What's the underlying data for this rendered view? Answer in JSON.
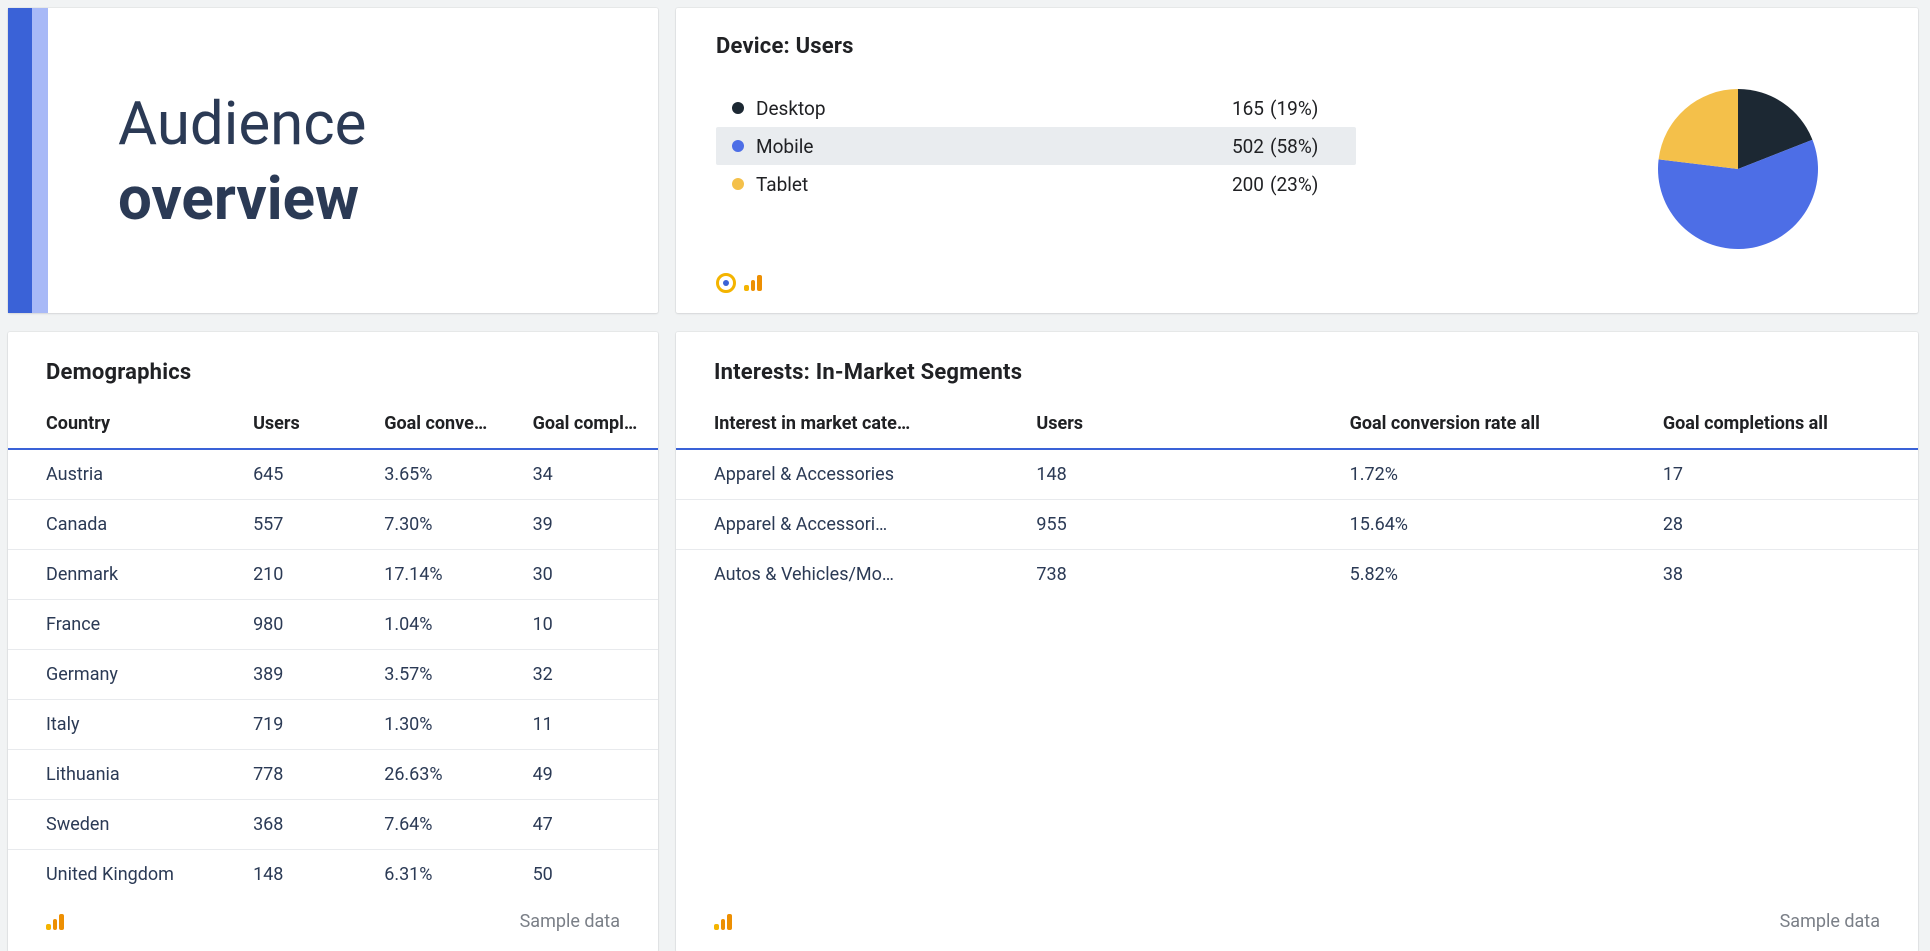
{
  "colors": {
    "accent": "#3a62d7",
    "accent_light": "#a8b9f7",
    "yellow": "#f4b400",
    "dark": "#1c2833"
  },
  "title": {
    "line1": "Audience",
    "line2": "overview"
  },
  "device_card": {
    "title": "Device: Users",
    "selected_index": 1,
    "rows": [
      {
        "label": "Desktop",
        "value": "165",
        "pct": "(19%)",
        "color": "#1c2833"
      },
      {
        "label": "Mobile",
        "value": "502",
        "pct": "(58%)",
        "color": "#4d6ee6"
      },
      {
        "label": "Tablet",
        "value": "200",
        "pct": "(23%)",
        "color": "#f4c04a"
      }
    ]
  },
  "demographics": {
    "title": "Demographics",
    "columns": [
      "Country",
      "Users",
      "Goal conve…",
      "Goal compl…"
    ],
    "rows": [
      {
        "c0": "Austria",
        "c1": "645",
        "c2": "3.65%",
        "c3": "34"
      },
      {
        "c0": "Canada",
        "c1": "557",
        "c2": "7.30%",
        "c3": "39"
      },
      {
        "c0": "Denmark",
        "c1": "210",
        "c2": "17.14%",
        "c3": "30"
      },
      {
        "c0": "France",
        "c1": "980",
        "c2": "1.04%",
        "c3": "10"
      },
      {
        "c0": "Germany",
        "c1": "389",
        "c2": "3.57%",
        "c3": "32"
      },
      {
        "c0": "Italy",
        "c1": "719",
        "c2": "1.30%",
        "c3": "11"
      },
      {
        "c0": "Lithuania",
        "c1": "778",
        "c2": "26.63%",
        "c3": "49"
      },
      {
        "c0": "Sweden",
        "c1": "368",
        "c2": "7.64%",
        "c3": "47"
      },
      {
        "c0": "United Kingdom",
        "c1": "148",
        "c2": "6.31%",
        "c3": "50"
      }
    ],
    "footer_note": "Sample data"
  },
  "interests": {
    "title": "Interests: In-Market Segments",
    "columns": [
      "Interest in market cate…",
      "Users",
      "Goal conversion rate all",
      "Goal completions all"
    ],
    "rows": [
      {
        "c0": "Apparel & Accessories",
        "c1": "148",
        "c2": "1.72%",
        "c3": "17"
      },
      {
        "c0": "Apparel & Accessori…",
        "c1": "955",
        "c2": "15.64%",
        "c3": "28"
      },
      {
        "c0": "Autos & Vehicles/Mo…",
        "c1": "738",
        "c2": "5.82%",
        "c3": "38"
      }
    ],
    "footer_note": "Sample data"
  },
  "chart_data": {
    "type": "pie",
    "title": "Device: Users",
    "series": [
      {
        "name": "Desktop",
        "value": 165,
        "percent": 19,
        "color": "#1c2833"
      },
      {
        "name": "Mobile",
        "value": 502,
        "percent": 58,
        "color": "#4d6ee6"
      },
      {
        "name": "Tablet",
        "value": 200,
        "percent": 23,
        "color": "#f4c04a"
      }
    ]
  }
}
